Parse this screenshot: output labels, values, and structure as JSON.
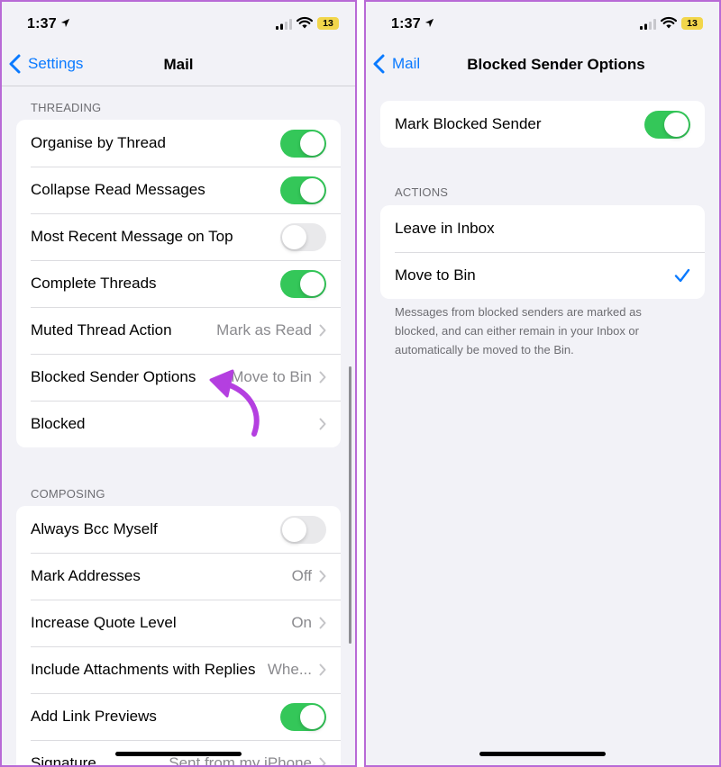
{
  "left": {
    "status": {
      "time": "1:37",
      "battery": "13"
    },
    "nav": {
      "back_label": "Settings",
      "title": "Mail"
    },
    "threading": {
      "header": "THREADING",
      "rows": [
        {
          "label": "Organise by Thread",
          "toggle": "on"
        },
        {
          "label": "Collapse Read Messages",
          "toggle": "on"
        },
        {
          "label": "Most Recent Message on Top",
          "toggle": "off"
        },
        {
          "label": "Complete Threads",
          "toggle": "on"
        },
        {
          "label": "Muted Thread Action",
          "value": "Mark as Read"
        },
        {
          "label": "Blocked Sender Options",
          "value": "Move to Bin"
        },
        {
          "label": "Blocked",
          "value": ""
        }
      ]
    },
    "composing": {
      "header": "COMPOSING",
      "rows": [
        {
          "label": "Always Bcc Myself",
          "toggle": "off"
        },
        {
          "label": "Mark Addresses",
          "value": "Off"
        },
        {
          "label": "Increase Quote Level",
          "value": "On"
        },
        {
          "label": "Include Attachments with Replies",
          "value": "Whe..."
        },
        {
          "label": "Add Link Previews",
          "toggle": "on"
        },
        {
          "label": "Signature",
          "value": "Sent from my iPhone"
        }
      ]
    }
  },
  "right": {
    "status": {
      "time": "1:37",
      "battery": "13"
    },
    "nav": {
      "back_label": "Mail",
      "title": "Blocked Sender Options"
    },
    "mark_blocked": {
      "label": "Mark Blocked Sender",
      "toggle": "on"
    },
    "actions": {
      "header": "ACTIONS",
      "options": [
        {
          "label": "Leave in Inbox",
          "selected": false
        },
        {
          "label": "Move to Bin",
          "selected": true
        }
      ]
    },
    "footer_lines": [
      "Messages from blocked senders are marked as",
      "blocked, and can either remain in your Inbox or",
      "automatically be moved to the Bin."
    ]
  },
  "colors": {
    "accent": "#0a7aff",
    "toggle_on": "#34c759",
    "annotation_arrow": "#b43fe0",
    "frame_border": "#b86ad6"
  }
}
